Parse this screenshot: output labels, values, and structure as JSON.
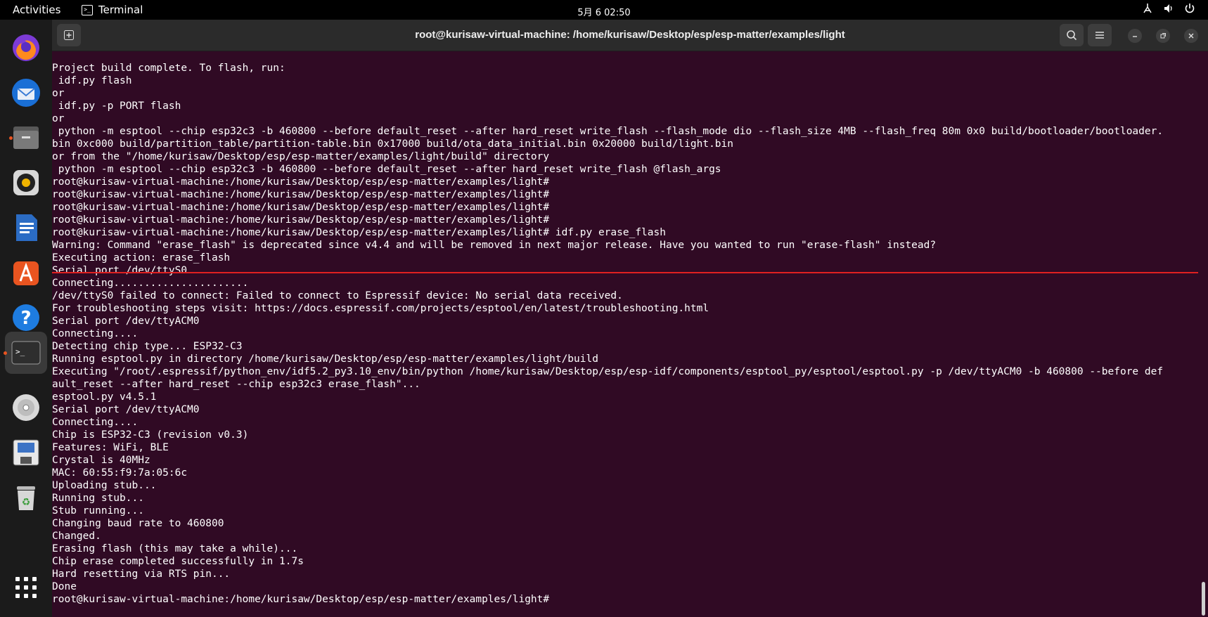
{
  "topbar": {
    "activities": "Activities",
    "app_name": "Terminal",
    "clock": "5月 6  02:50"
  },
  "dock": {
    "items": [
      "firefox-icon",
      "thunderbird-icon",
      "files-icon",
      "rhythmbox-icon",
      "libreoffice-writer-icon",
      "app-center-icon",
      "help-icon",
      "terminal-icon",
      "disc-icon",
      "save-disk-icon",
      "trash-icon",
      "app-grid-icon"
    ]
  },
  "window": {
    "title": "root@kurisaw-virtual-machine: /home/kurisaw/Desktop/esp/esp-matter/examples/light"
  },
  "terminal": {
    "lines": [
      "",
      "Project build complete. To flash, run:",
      " idf.py flash",
      "or",
      " idf.py -p PORT flash",
      "or",
      " python -m esptool --chip esp32c3 -b 460800 --before default_reset --after hard_reset write_flash --flash_mode dio --flash_size 4MB --flash_freq 80m 0x0 build/bootloader/bootloader.",
      "bin 0xc000 build/partition_table/partition-table.bin 0x17000 build/ota_data_initial.bin 0x20000 build/light.bin",
      "or from the \"/home/kurisaw/Desktop/esp/esp-matter/examples/light/build\" directory",
      " python -m esptool --chip esp32c3 -b 460800 --before default_reset --after hard_reset write_flash @flash_args",
      "root@kurisaw-virtual-machine:/home/kurisaw/Desktop/esp/esp-matter/examples/light#",
      "root@kurisaw-virtual-machine:/home/kurisaw/Desktop/esp/esp-matter/examples/light#",
      "root@kurisaw-virtual-machine:/home/kurisaw/Desktop/esp/esp-matter/examples/light#",
      "root@kurisaw-virtual-machine:/home/kurisaw/Desktop/esp/esp-matter/examples/light#",
      "root@kurisaw-virtual-machine:/home/kurisaw/Desktop/esp/esp-matter/examples/light# idf.py erase_flash",
      "Warning: Command \"erase_flash\" is deprecated since v4.4 and will be removed in next major release. Have you wanted to run \"erase-flash\" instead?",
      "Executing action: erase_flash",
      "Serial port /dev/ttyS0",
      "Connecting......................",
      "/dev/ttyS0 failed to connect: Failed to connect to Espressif device: No serial data received.",
      "For troubleshooting steps visit: https://docs.espressif.com/projects/esptool/en/latest/troubleshooting.html",
      "Serial port /dev/ttyACM0",
      "Connecting....",
      "Detecting chip type... ESP32-C3",
      "Running esptool.py in directory /home/kurisaw/Desktop/esp/esp-matter/examples/light/build",
      "Executing \"/root/.espressif/python_env/idf5.2_py3.10_env/bin/python /home/kurisaw/Desktop/esp/esp-idf/components/esptool_py/esptool/esptool.py -p /dev/ttyACM0 -b 460800 --before def",
      "ault_reset --after hard_reset --chip esp32c3 erase_flash\"...",
      "esptool.py v4.5.1",
      "Serial port /dev/ttyACM0",
      "Connecting....",
      "Chip is ESP32-C3 (revision v0.3)",
      "Features: WiFi, BLE",
      "Crystal is 40MHz",
      "MAC: 60:55:f9:7a:05:6c",
      "Uploading stub...",
      "Running stub...",
      "Stub running...",
      "Changing baud rate to 460800",
      "Changed.",
      "Erasing flash (this may take a while)...",
      "Chip erase completed successfully in 1.7s",
      "Hard resetting via RTS pin...",
      "Done",
      "root@kurisaw-virtual-machine:/home/kurisaw/Desktop/esp/esp-matter/examples/light#"
    ]
  }
}
